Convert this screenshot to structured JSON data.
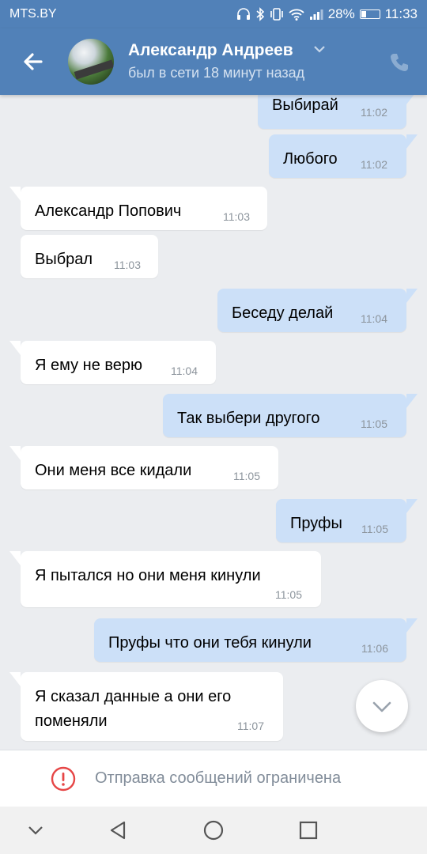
{
  "status_bar": {
    "carrier": "MTS.BY",
    "battery": "28%",
    "battery_level": 0.28,
    "time": "11:33"
  },
  "header": {
    "contact_name": "Александр Андреев",
    "status": "был в сети 18 минут назад",
    "icons": {
      "back": "arrow-left-icon",
      "dropdown": "chevron-down-icon",
      "call": "phone-icon"
    }
  },
  "messages": [
    {
      "dir": "out",
      "text": "Выбирай",
      "time": "11:02"
    },
    {
      "dir": "out",
      "text": "Любого",
      "time": "11:02"
    },
    {
      "dir": "in",
      "text": "Александр Попович",
      "time": "11:03"
    },
    {
      "dir": "in",
      "text": "Выбрал",
      "time": "11:03"
    },
    {
      "dir": "out",
      "text": "Беседу делай",
      "time": "11:04"
    },
    {
      "dir": "in",
      "text": "Я ему не верю",
      "time": "11:04"
    },
    {
      "dir": "out",
      "text": "Так выбери другого",
      "time": "11:05"
    },
    {
      "dir": "in",
      "text": "Они меня все кидали",
      "time": "11:05"
    },
    {
      "dir": "out",
      "text": "Пруфы",
      "time": "11:05"
    },
    {
      "dir": "in",
      "text": "Я пытался но они меня кинули",
      "time": "11:05"
    },
    {
      "dir": "out",
      "text": "Пруфы что они тебя кинули",
      "time": "11:06"
    },
    {
      "dir": "in",
      "text": "Я сказал данные а они его\nпоменяли",
      "time": "11:07"
    }
  ],
  "restriction": {
    "text": "Отправка сообщений ограничена",
    "icon": "warning-circle-icon",
    "color": "#e64646"
  },
  "nav_icons": [
    "chevron-down-icon",
    "back-triangle-icon",
    "home-circle-icon",
    "recents-square-icon"
  ],
  "colors": {
    "brand": "#5181b8",
    "outgoing_bubble": "#cce0f8",
    "incoming_bubble": "#ffffff",
    "background": "#ebedf0"
  }
}
